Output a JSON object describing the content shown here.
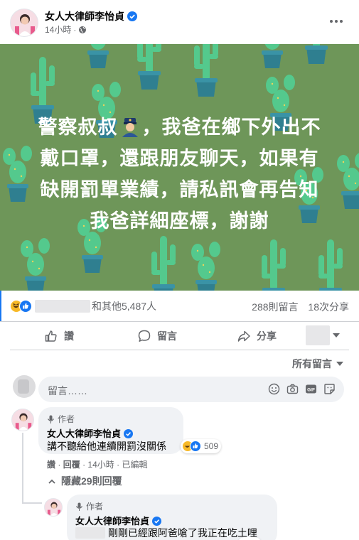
{
  "post": {
    "author": "女人大律師李怡貞",
    "time": "14小時",
    "separator": "·",
    "image_text": [
      "警察叔叔",
      "，我爸在鄉下外出不",
      "戴口罩，還跟朋友聊天，如果有",
      "缺開罰單業績，請私訊會再告知",
      "我爸詳細座標，謝謝"
    ]
  },
  "reactions": {
    "others": "和其他5,487人",
    "comments": "288則留言",
    "shares": "18次分享"
  },
  "actions": {
    "like": "讚",
    "comment": "留言",
    "share": "分享"
  },
  "sort_label": "所有留言",
  "composer": {
    "placeholder": "留言……"
  },
  "comments": [
    {
      "author_tag": "作者",
      "name": "女人大律師李怡貞",
      "text": "講不聽給他連續開罰沒關係",
      "reaction_count": "509",
      "meta": {
        "like": "讚",
        "dot": "·",
        "reply": "回覆",
        "time": "14小時",
        "edited": "已編輯"
      }
    }
  ],
  "hide_replies": "隱藏29則回覆",
  "reply": {
    "author_tag": "作者",
    "name": "女人大律師李怡貞",
    "text": "剛剛已經跟阿爸嗆了我正在吃土哩"
  },
  "colors": {
    "accent": "#1877f2",
    "image_bg": "#6e9659",
    "cactus": "#54c98d",
    "pot": "#2f7f90",
    "text_secondary": "#65676b"
  }
}
